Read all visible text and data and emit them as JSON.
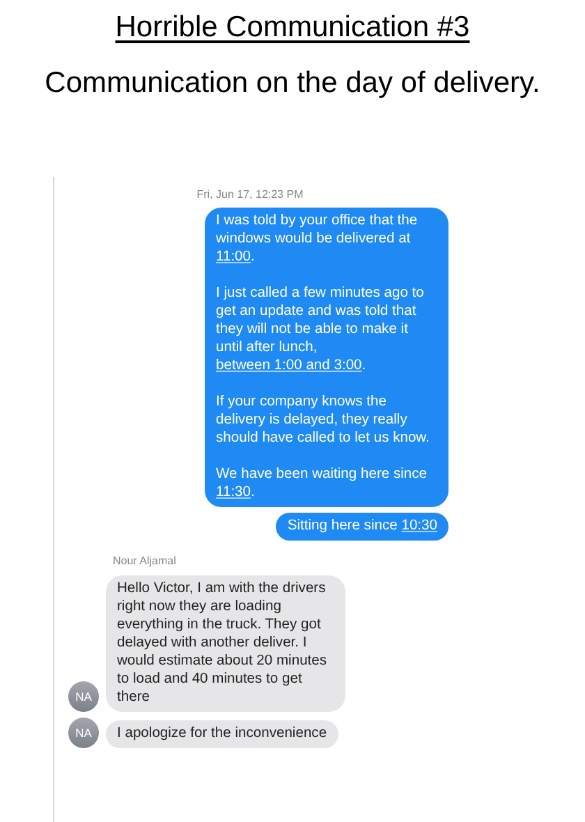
{
  "slide": {
    "title": "Horrible Communication #3",
    "subtitle": "Communication on the day of delivery."
  },
  "conversation": {
    "timestamp": "Fri, Jun 17, 12:23 PM",
    "messages": [
      {
        "kind": "sent",
        "paragraphs": [
          [
            {
              "text": "I was told by your office that the windows would be delivered at "
            },
            {
              "text": "11:00",
              "link": true
            },
            {
              "text": "."
            }
          ],
          [
            {
              "text": "I just called a few minutes ago to get an update and was told that they will not be able to make it until after lunch, "
            },
            {
              "text": "between 1:00 and 3:00",
              "link": true
            },
            {
              "text": "."
            }
          ],
          [
            {
              "text": "If your company knows the delivery is delayed, they really should have called to let us know."
            }
          ],
          [
            {
              "text": "We have been waiting here since "
            },
            {
              "text": "11:30",
              "link": true
            },
            {
              "text": "."
            }
          ]
        ]
      },
      {
        "kind": "sent",
        "paragraphs": [
          [
            {
              "text": "Sitting here since "
            },
            {
              "text": "10:30",
              "link": true
            }
          ]
        ]
      },
      {
        "kind": "received",
        "sender": "Nour Aljamal",
        "avatar": "NA",
        "paragraphs": [
          [
            {
              "text": "Hello Victor,  I am with the drivers right now they are loading everything in the truck. They got delayed with another deliver. I would estimate about 20 minutes to load and 40 minutes to get there"
            }
          ]
        ]
      },
      {
        "kind": "received",
        "avatar": "NA",
        "paragraphs": [
          [
            {
              "text": "I apologize for the inconvenience"
            }
          ]
        ]
      }
    ]
  }
}
